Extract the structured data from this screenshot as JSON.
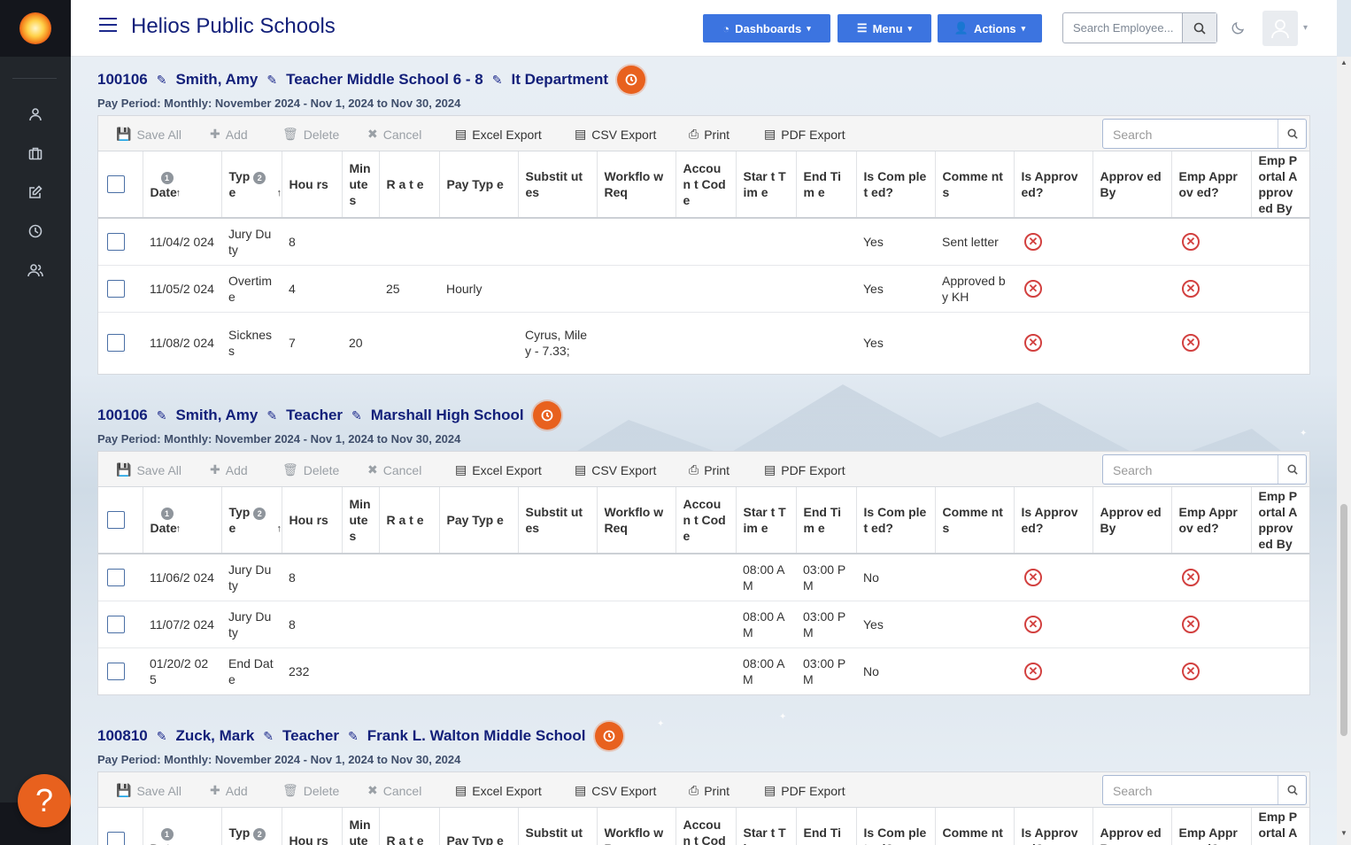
{
  "app": {
    "title": "Helios Public Schools"
  },
  "topbar": {
    "dashboards_label": "Dashboards",
    "menu_label": "Menu",
    "actions_label": "Actions",
    "search_placeholder": "Search Employee..."
  },
  "sidebar": {
    "items": [
      {
        "icon": "person-icon"
      },
      {
        "icon": "briefcase-icon"
      },
      {
        "icon": "edit-icon"
      },
      {
        "icon": "clock-icon"
      },
      {
        "icon": "users-icon"
      }
    ]
  },
  "help_label": "?",
  "toolbar": {
    "save_all": "Save All",
    "add": "Add",
    "delete": "Delete",
    "cancel": "Cancel",
    "excel_export": "Excel Export",
    "csv_export": "CSV Export",
    "print": "Print",
    "pdf_export": "PDF Export",
    "search_placeholder": "Search"
  },
  "columns": [
    "Date",
    "Type",
    "Hours",
    "Minutes",
    "Rate",
    "Pay Type",
    "Substitutes",
    "Workflow Req",
    "Account Code",
    "Start Time",
    "End Time",
    "Is Completed?",
    "Comments",
    "Is Approved?",
    "Approved By",
    "Emp Approved?",
    "Emp Portal Approved By"
  ],
  "column_display": [
    "Date",
    "Typ e",
    "Hou rs",
    "Min utes",
    "R a t e",
    "Pay Typ e",
    "Substit utes",
    "Workflo w Req",
    "Accoun t Code",
    "Star t Tim e",
    "End Tim e",
    "Is Com plet ed?",
    "Comme nts",
    "Is Approv ed?",
    "Approv ed By",
    "Emp Approv ed?",
    "Emp Portal Approv ed By"
  ],
  "sort_badges": {
    "date": "1",
    "type": "2"
  },
  "sections": [
    {
      "emp_id": "100106",
      "name": "Smith, Amy",
      "position": "Teacher Middle School 6 - 8",
      "location": "It Department",
      "pay_period": "Pay Period: Monthly: November 2024 - Nov 1, 2024 to Nov 30, 2024",
      "rows": [
        {
          "date": "11/04/2 024",
          "type": "Jury Duty",
          "hours": "8",
          "minutes": "",
          "rate": "",
          "pay_type": "",
          "subs": "",
          "start": "",
          "end": "",
          "completed": "Yes",
          "comments": "Sent letter"
        },
        {
          "date": "11/05/2 024",
          "type": "Overtime",
          "hours": "4",
          "minutes": "",
          "rate": "25",
          "pay_type": "Hourly",
          "subs": "",
          "start": "",
          "end": "",
          "completed": "Yes",
          "comments": "Approved by KH"
        },
        {
          "date": "11/08/2 024",
          "type": "Sickness",
          "hours": "7",
          "minutes": "20",
          "rate": "",
          "pay_type": "",
          "subs": "Cyrus, Miley - 7.33;",
          "start": "",
          "end": "",
          "completed": "Yes",
          "comments": ""
        }
      ]
    },
    {
      "emp_id": "100106",
      "name": "Smith, Amy",
      "position": "Teacher",
      "location": "Marshall High School",
      "pay_period": "Pay Period: Monthly: November 2024 - Nov 1, 2024 to Nov 30, 2024",
      "rows": [
        {
          "date": "11/06/2 024",
          "type": "Jury Duty",
          "hours": "8",
          "minutes": "",
          "rate": "",
          "pay_type": "",
          "subs": "",
          "start": "08:00 AM",
          "end": "03:00 PM",
          "completed": "No",
          "comments": ""
        },
        {
          "date": "11/07/2 024",
          "type": "Jury Duty",
          "hours": "8",
          "minutes": "",
          "rate": "",
          "pay_type": "",
          "subs": "",
          "start": "08:00 AM",
          "end": "03:00 PM",
          "completed": "Yes",
          "comments": ""
        },
        {
          "date": "01/20/2 025",
          "type": "End Date",
          "hours": "232",
          "minutes": "",
          "rate": "",
          "pay_type": "",
          "subs": "",
          "start": "08:00 AM",
          "end": "03:00 PM",
          "completed": "No",
          "comments": ""
        }
      ]
    },
    {
      "emp_id": "100810",
      "name": "Zuck, Mark",
      "position": "Teacher",
      "location": "Frank L. Walton Middle School",
      "pay_period": "Pay Period: Monthly: November 2024 - Nov 1, 2024 to Nov 30, 2024",
      "rows": []
    }
  ],
  "colors": {
    "brand": "#13207a",
    "button": "#3c74e0",
    "accent": "#e8611e",
    "reject": "#d2403f"
  }
}
